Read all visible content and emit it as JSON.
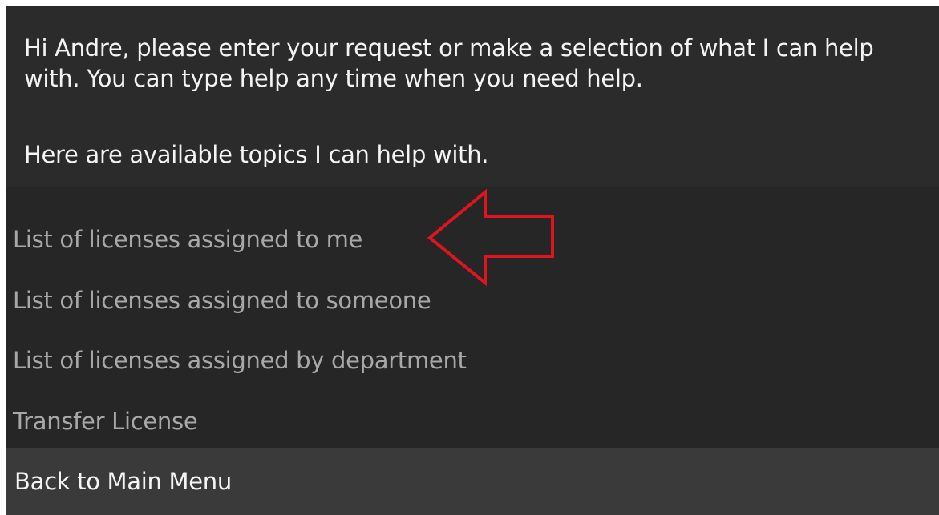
{
  "message": {
    "greeting": "Hi Andre, please enter your request or make a selection of what I can help with. You can type help any time when you need help.",
    "topics_intro": "Here are available topics I can help with."
  },
  "options": [
    {
      "label": "List of licenses assigned to me"
    },
    {
      "label": "List of licenses assigned to someone"
    },
    {
      "label": "List of licenses assigned by department"
    },
    {
      "label": "Transfer License"
    }
  ],
  "back": {
    "label": "Back to Main Menu"
  },
  "annotation": {
    "icon": "red-outline-arrow-icon",
    "color": "#e0141e"
  }
}
